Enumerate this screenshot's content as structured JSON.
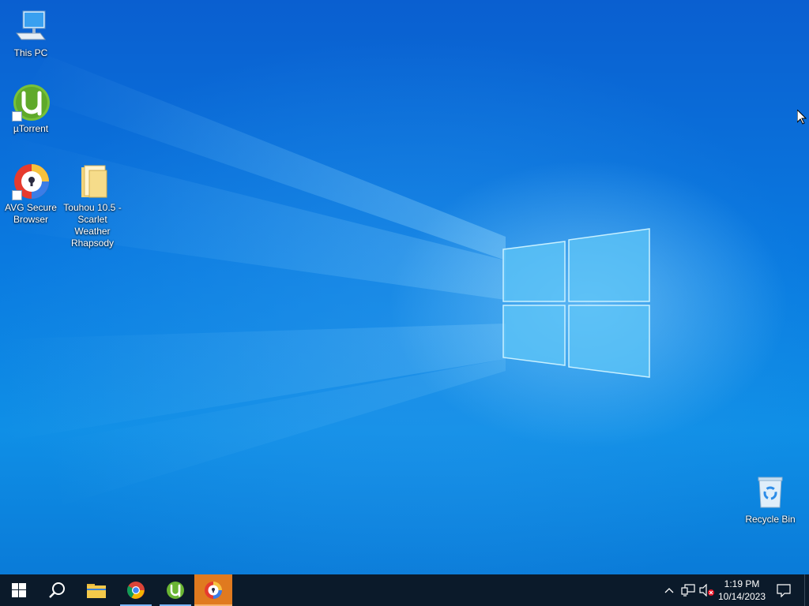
{
  "desktop": {
    "icons": [
      {
        "label": "This PC",
        "icon": "this-pc-icon"
      },
      {
        "label": "µTorrent",
        "icon": "utorrent-icon"
      },
      {
        "label": "AVG Secure Browser",
        "icon": "avg-browser-icon"
      },
      {
        "label": "Touhou 10.5 - Scarlet Weather Rhapsody",
        "icon": "folder-icon"
      },
      {
        "label": "Recycle Bin",
        "icon": "recycle-bin-icon"
      }
    ]
  },
  "taskbar": {
    "buttons": [
      {
        "icon": "windows-start-icon"
      },
      {
        "icon": "search-icon"
      },
      {
        "icon": "file-explorer-icon"
      },
      {
        "icon": "chrome-icon"
      },
      {
        "icon": "utorrent-icon"
      },
      {
        "icon": "avg-browser-icon"
      }
    ],
    "tray": {
      "icons": [
        "chevron-up-icon",
        "network-icon",
        "volume-muted-icon"
      ],
      "time": "1:19 PM",
      "date": "10/14/2023",
      "notification_icon": "action-center-icon"
    }
  },
  "colors": {
    "taskbar_bg": "#0b1a2a",
    "active_app": "#e07a1f",
    "desktop_accent": "#0a7ae0"
  }
}
